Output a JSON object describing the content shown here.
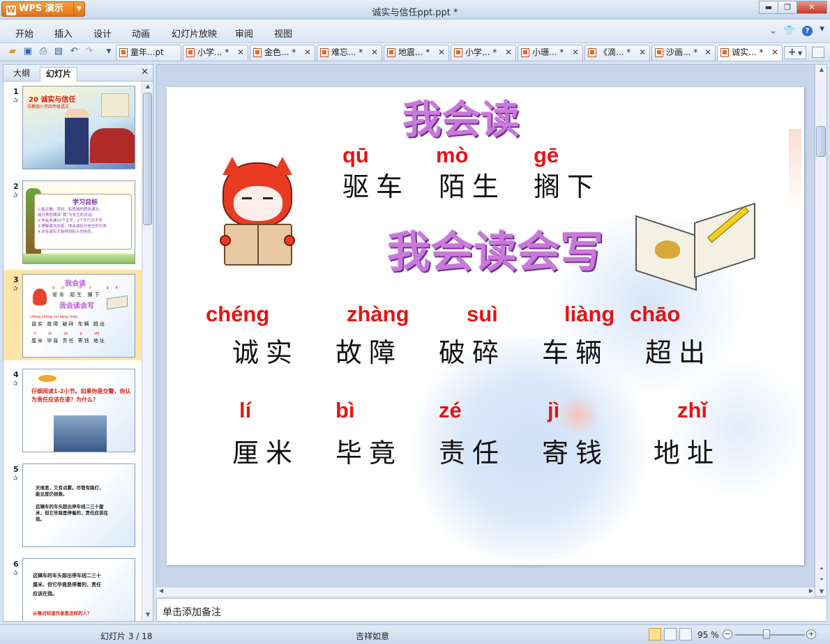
{
  "app": {
    "name": "WPS 演示",
    "logo": "W",
    "window_title": "诚实与信任ppt.ppt *"
  },
  "window_controls": {
    "minimize": "▬",
    "restore": "❐",
    "close": "✕"
  },
  "menu": {
    "items": [
      "开始",
      "插入",
      "设计",
      "动画",
      "幻灯片放映",
      "审阅",
      "视图"
    ]
  },
  "doc_tabs": [
    {
      "label": "童年...pt",
      "close": ""
    },
    {
      "label": "小学... *",
      "close": "✕"
    },
    {
      "label": "金色... *",
      "close": "✕"
    },
    {
      "label": "难忘... *",
      "close": "✕"
    },
    {
      "label": "地震... *",
      "close": "✕"
    },
    {
      "label": "小学... *",
      "close": "✕"
    },
    {
      "label": "小珊... *",
      "close": "✕"
    },
    {
      "label": "《滴... *",
      "close": "✕"
    },
    {
      "label": "沙画... *",
      "close": "✕"
    },
    {
      "label": "诚实... *",
      "close": "✕"
    }
  ],
  "left_pane": {
    "tabs": [
      "大纲",
      "幻灯片"
    ],
    "close": "✕",
    "thumbnails": [
      {
        "num": "1",
        "star": "✰",
        "title": "20 诚实与信任",
        "subtitle": "苏教版小学四年级语文"
      },
      {
        "num": "2",
        "star": "✰",
        "title": "学习目标",
        "lines": [
          "1.能正确、流利、有感情的朗读课文，",
          "能分角色朗读“我”与车主的对话。",
          "2.学会本课10个生字，2个字只识不写",
          "3.理解课文内容，体会诚实与信任的可贵",
          "4.并有诚实才能得到别人的信任。"
        ]
      },
      {
        "num": "3",
        "star": "✰",
        "title": "我会读",
        "subtitle": "我会读会写"
      },
      {
        "num": "4",
        "star": "✰",
        "text": "仔细阅读1-2小节。如果你是交警，你认为责任应该在谁？为什么？"
      },
      {
        "num": "5",
        "star": "✰",
        "lines": [
          "天很黑，又有点雾。尽管有路灯，",
          "能见度仍很差。",
          "",
          "这辆车的车头超出停车线二三十厘",
          "米，但它毕竟是停着的，责任应该在",
          "我。"
        ]
      },
      {
        "num": "6",
        "star": "✰",
        "lines": [
          "这辆车的车头超出停车线二三十",
          "厘米，但它毕竟是停着的，责任",
          "应该在我。"
        ],
        "question": "从哪点知道作者是怎样的人？"
      }
    ]
  },
  "slide": {
    "heading_read": "我会读",
    "heading_read_write": "我会读会写",
    "row1": [
      {
        "pinyin": "qū",
        "word": "驱车"
      },
      {
        "pinyin": "mò",
        "word": "陌生"
      },
      {
        "pinyin": "gē",
        "word": "搁下"
      }
    ],
    "row2": [
      {
        "pinyin": "chéng",
        "word": "诚实"
      },
      {
        "pinyin": "zhàng",
        "word": "故障"
      },
      {
        "pinyin": "suì",
        "word": "破碎"
      },
      {
        "pinyin": "liàng",
        "word": "车辆"
      },
      {
        "pinyin": "chāo",
        "word": "超出"
      }
    ],
    "row3": [
      {
        "pinyin": "lí",
        "word": "厘米"
      },
      {
        "pinyin": "bì",
        "word": "毕竟"
      },
      {
        "pinyin": "zé",
        "word": "责任"
      },
      {
        "pinyin": "jì",
        "word": "寄钱"
      },
      {
        "pinyin": "zhǐ",
        "word": "地址"
      }
    ]
  },
  "notes_placeholder": "单击添加备注",
  "status": {
    "slide_indicator": "幻灯片 3 / 18",
    "theme": "吉祥如意",
    "zoom": "95 %"
  },
  "colors": {
    "pinyin": "#e41414",
    "wordart": "#c77ad8",
    "selection": "#fbe6a8"
  }
}
